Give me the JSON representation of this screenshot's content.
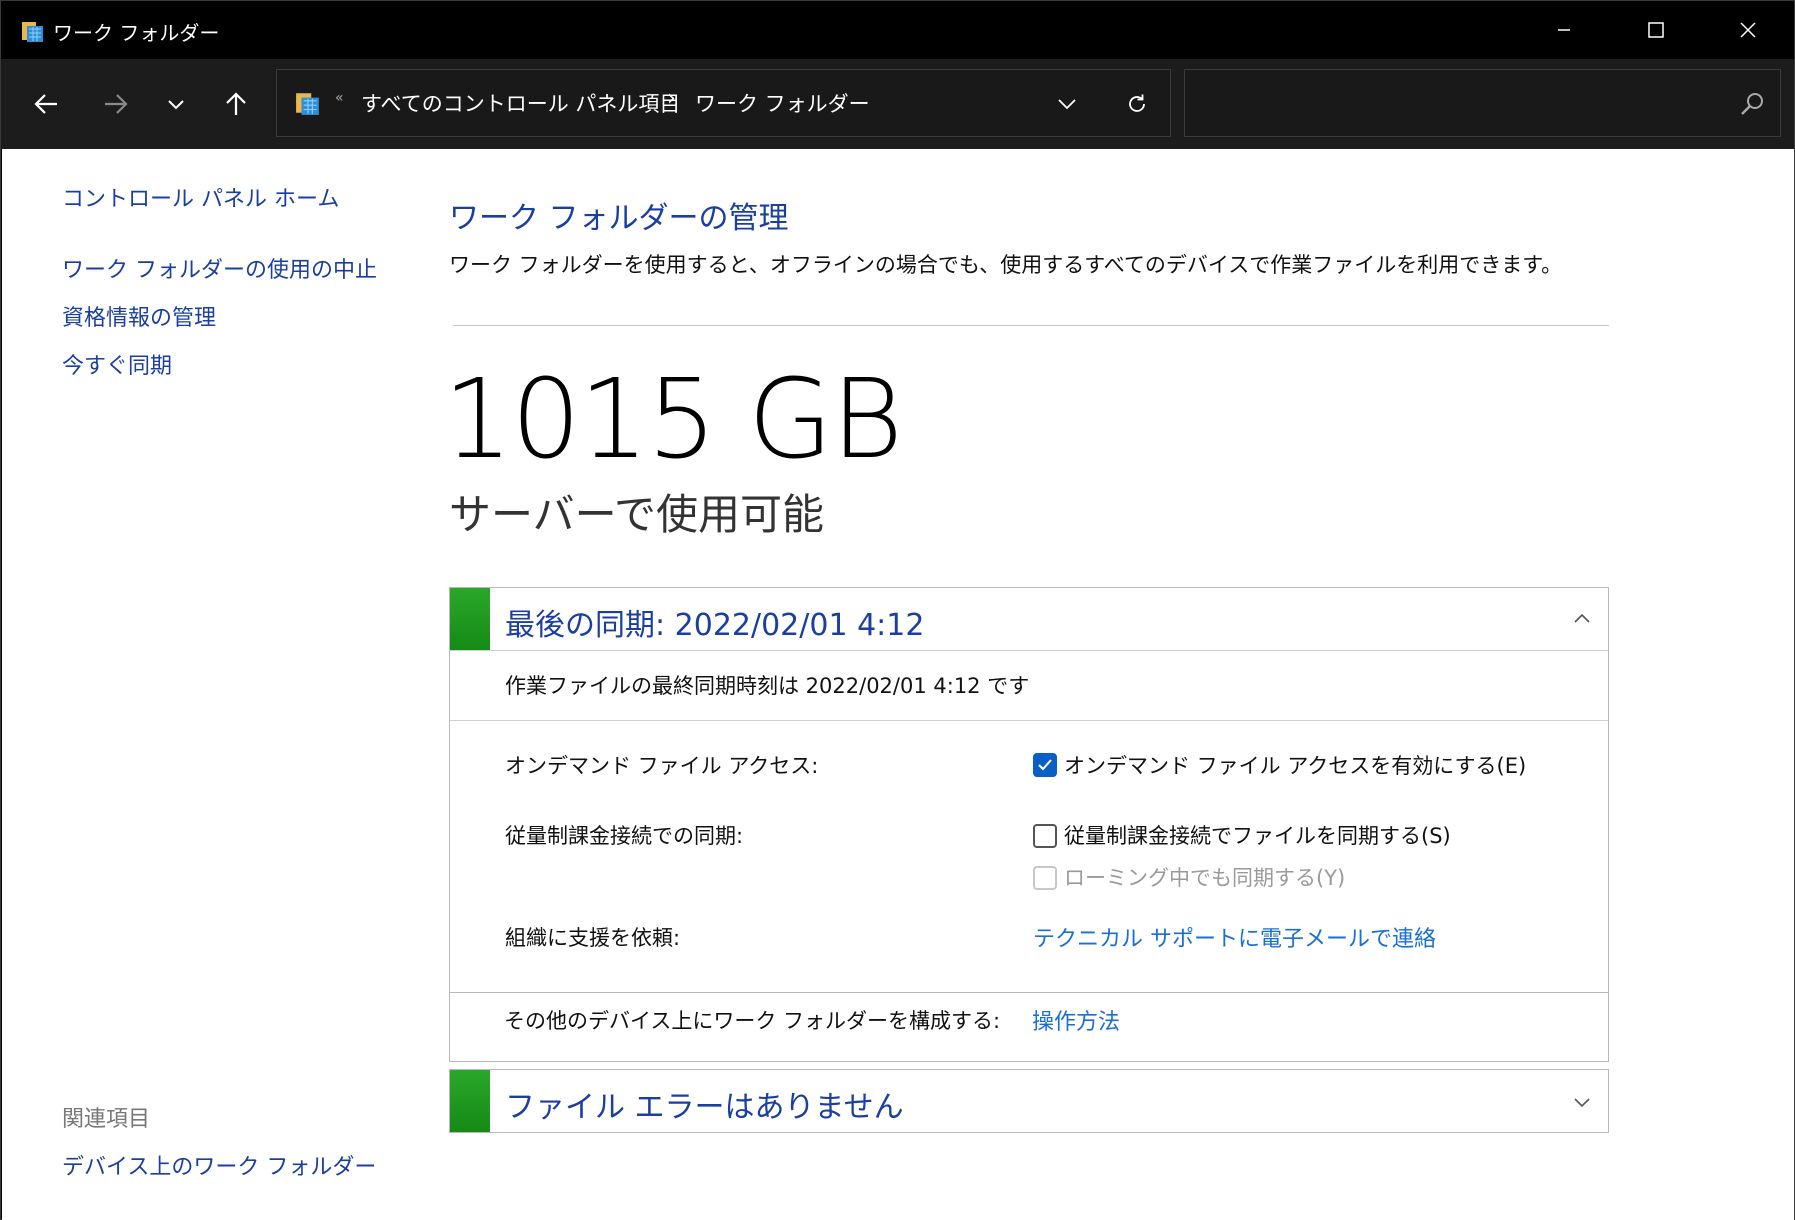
{
  "window": {
    "title": "ワーク フォルダー"
  },
  "address_bar": {
    "overflow": "«",
    "segments": [
      "すべてのコントロール パネル項目",
      "ワーク フォルダー"
    ],
    "separator": "›"
  },
  "search": {
    "placeholder": ""
  },
  "sidebar": {
    "home": "コントロール パネル ホーム",
    "links": [
      "ワーク フォルダーの使用の中止",
      "資格情報の管理",
      "今すぐ同期"
    ],
    "related_label": "関連項目",
    "related_links": [
      "デバイス上のワーク フォルダー"
    ]
  },
  "main": {
    "heading": "ワーク フォルダーの管理",
    "description": "ワーク フォルダーを使用すると、オフラインの場合でも、使用するすべてのデバイスで作業ファイルを利用できます。",
    "capacity": "1015 GB",
    "capacity_label": "サーバーで使用可能"
  },
  "sync_panel": {
    "title": "最後の同期: 2022/02/01 4:12",
    "detail": "作業ファイルの最終同期時刻は 2022/02/01 4:12 です",
    "rows": [
      {
        "label": "オンデマンド ファイル アクセス:",
        "option": "オンデマンド ファイル アクセスを有効にする(E)",
        "state": "checked"
      },
      {
        "label": "従量制課金接続での同期:",
        "option": "従量制課金接続でファイルを同期する(S)",
        "state": "unchecked",
        "sub_option": "ローミング中でも同期する(Y)",
        "sub_state": "disabled"
      },
      {
        "label": "組織に支援を依頼:",
        "link": "テクニカル サポートに電子メールで連絡"
      },
      {
        "label": "その他のデバイス上にワーク フォルダーを構成する:",
        "link": "操作方法"
      }
    ]
  },
  "error_panel": {
    "title": "ファイル エラーはありません"
  },
  "colors": {
    "link": "#1b3fa0",
    "accent_link": "#1a6fd6",
    "status_green": "#1f9a1f",
    "checkbox": "#0a5fc6"
  }
}
